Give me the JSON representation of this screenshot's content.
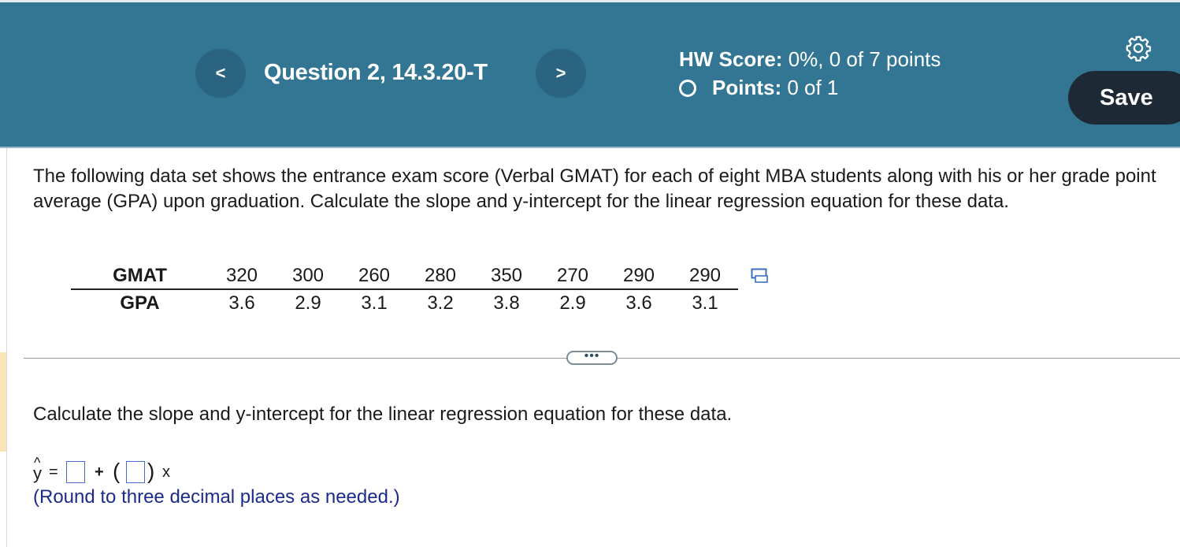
{
  "header": {
    "prev_label": "<",
    "next_label": ">",
    "question_title": "Question 2, 14.3.20-T",
    "hw_score_label": "HW Score:",
    "hw_score_value": "0%, 0 of 7 points",
    "points_label": "Points:",
    "points_value": "0 of 1",
    "save_label": "Save",
    "settings_icon": "gear-icon"
  },
  "intro_text": "The following data set shows the entrance exam score (Verbal GMAT) for each of eight MBA students along with his or her grade point average (GPA) upon graduation. Calculate the slope and y-intercept for the linear regression equation for these data.",
  "table": {
    "row_headers": [
      "GMAT",
      "GPA"
    ],
    "gmat": [
      "320",
      "300",
      "260",
      "280",
      "350",
      "270",
      "290",
      "290"
    ],
    "gpa": [
      "3.6",
      "2.9",
      "3.1",
      "3.2",
      "3.8",
      "2.9",
      "3.6",
      "3.1"
    ],
    "copy_icon": "copy-icon"
  },
  "more_label": "•••",
  "question_text": "Calculate the slope and y-intercept for the linear regression equation for these data.",
  "equation": {
    "y": "y",
    "hat": "^",
    "equals": "=",
    "plus": "+",
    "open_paren": "(",
    "close_paren": ")",
    "x": "x"
  },
  "hint_text": "(Round to three decimal places as needed.)",
  "colors": {
    "header_bg": "#337694",
    "save_bg": "#1d2a36",
    "hint_text": "#1b2b8c",
    "answer_box_border": "#4a6dd1"
  }
}
